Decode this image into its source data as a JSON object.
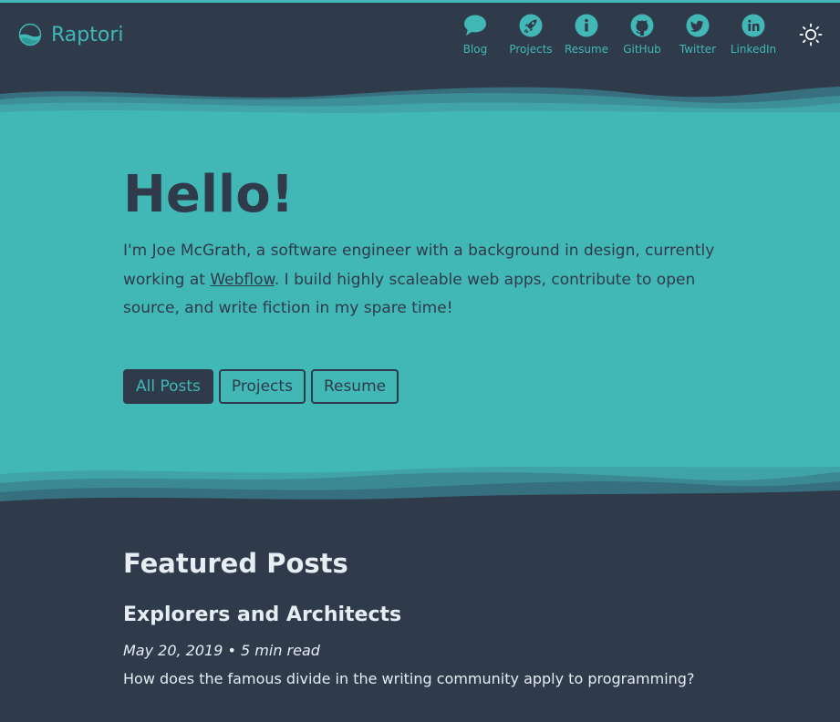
{
  "colors": {
    "accent": "#42b8b6",
    "background": "#2f3a4b",
    "text_light": "#e6edf3"
  },
  "header": {
    "brand": "Raptori",
    "nav": [
      {
        "label": "Blog",
        "icon": "chat-bubble-icon"
      },
      {
        "label": "Projects",
        "icon": "rocket-icon"
      },
      {
        "label": "Resume",
        "icon": "info-icon"
      },
      {
        "label": "GitHub",
        "icon": "github-icon"
      },
      {
        "label": "Twitter",
        "icon": "twitter-icon"
      },
      {
        "label": "LinkedIn",
        "icon": "linkedin-icon"
      }
    ],
    "theme_toggle_icon": "sun-icon"
  },
  "hero": {
    "title": "Hello!",
    "intro_before": "I'm Joe McGrath, a software engineer with a background in design, currently working at ",
    "intro_link": "Webflow",
    "intro_after": ". I build highly scaleable web apps, contribute to open source, and write fiction in my spare time!",
    "buttons": [
      "All Posts",
      "Projects",
      "Resume"
    ]
  },
  "featured": {
    "heading": "Featured Posts",
    "posts": [
      {
        "title": "Explorers and Architects",
        "meta": "May 20, 2019 • 5 min read",
        "excerpt": "How does the famous divide in the writing community apply to programming?"
      }
    ]
  }
}
